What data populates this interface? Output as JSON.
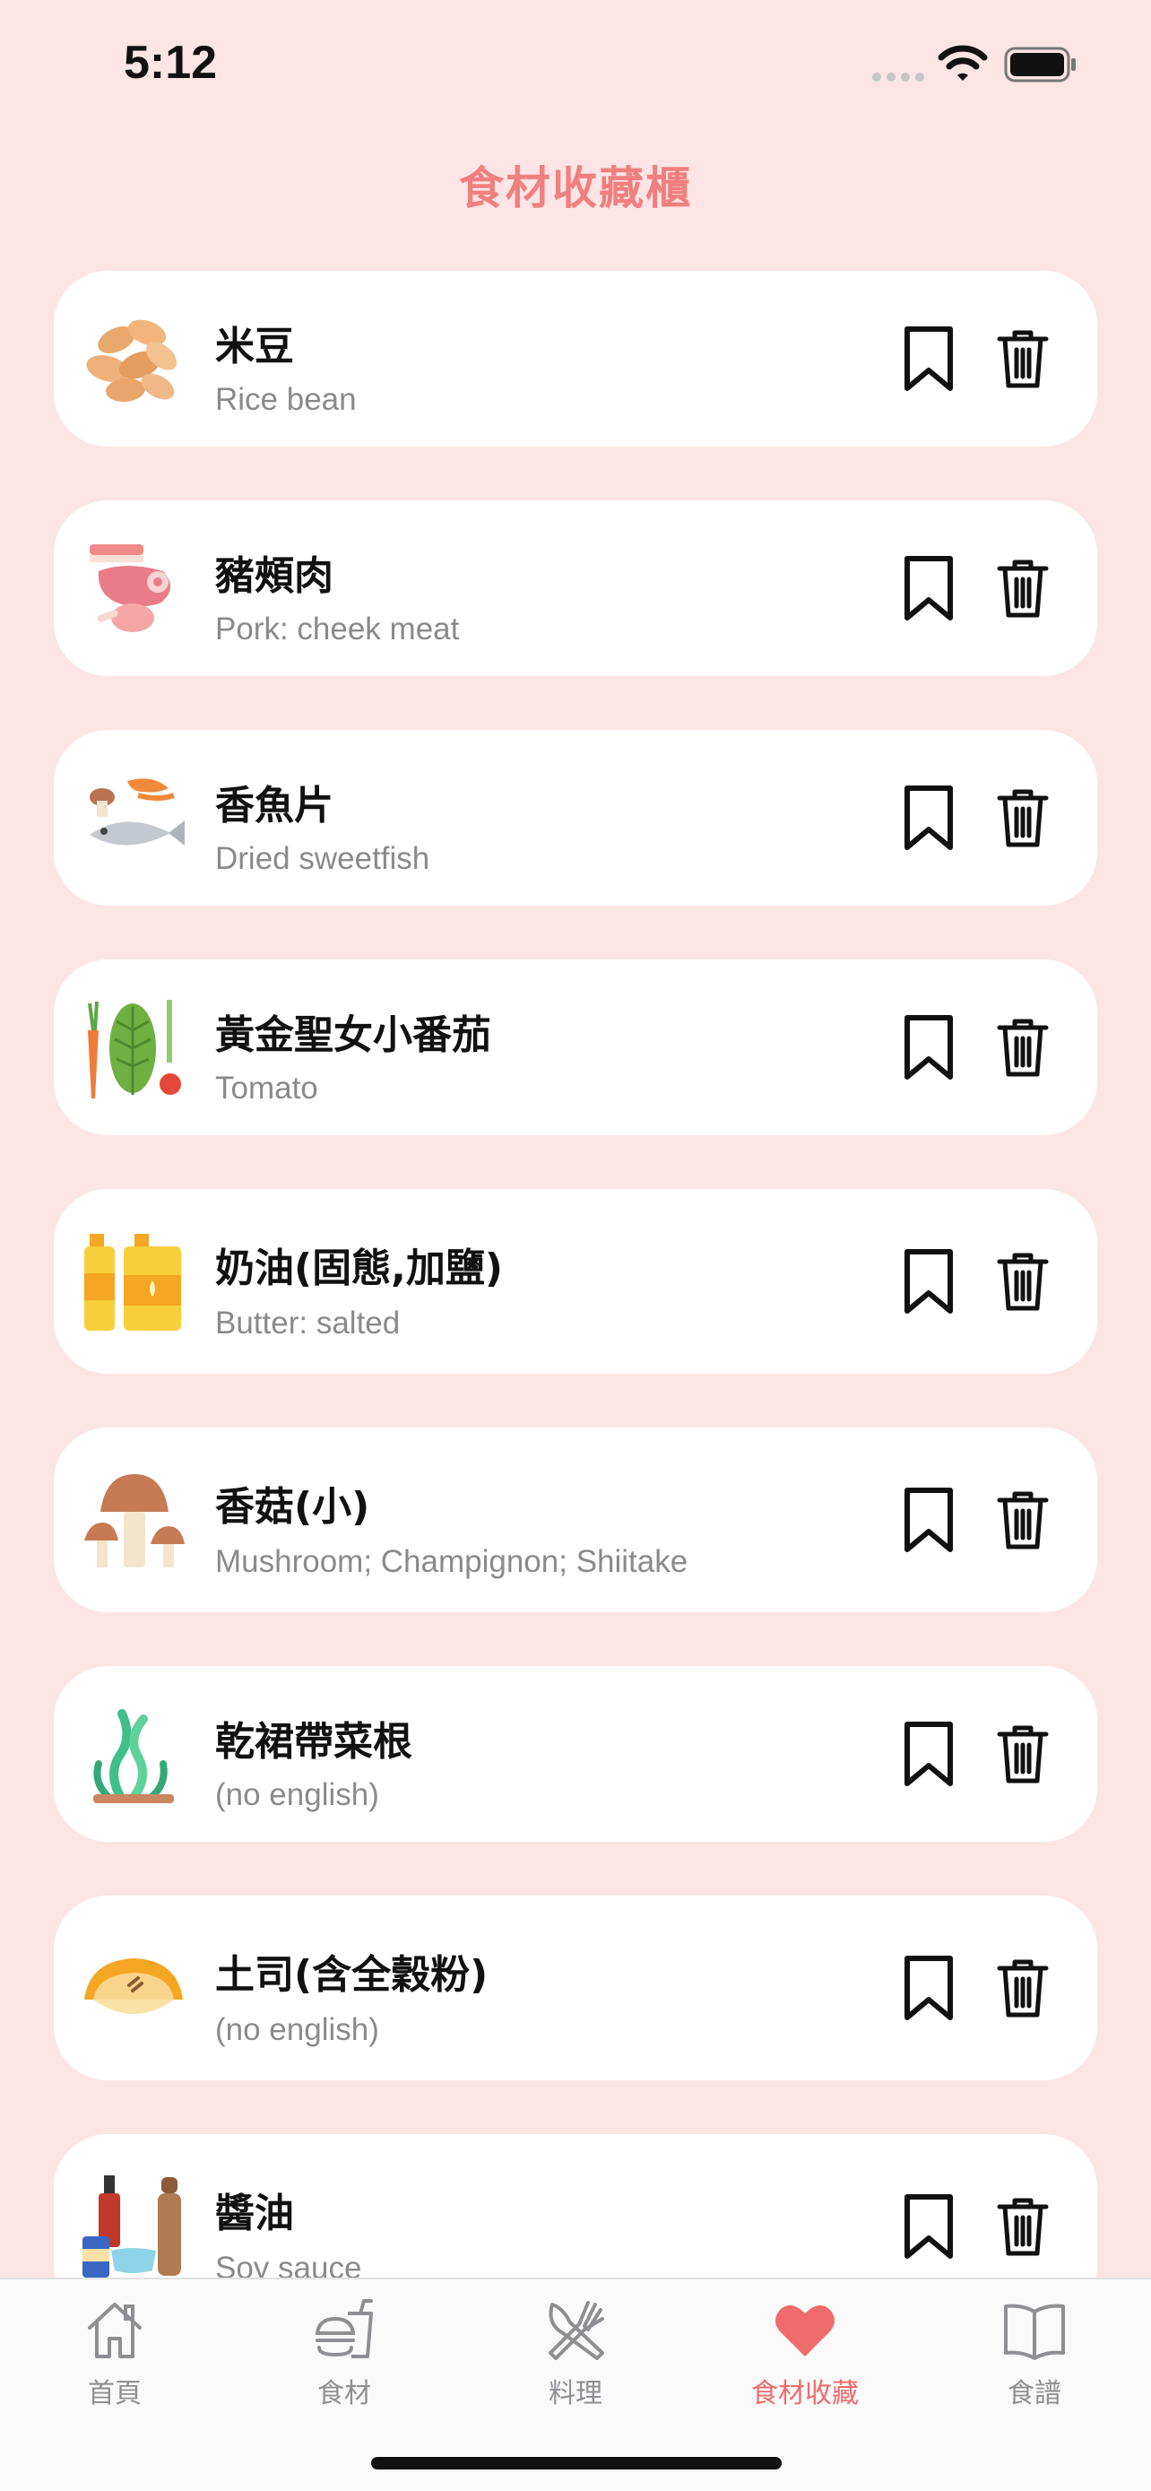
{
  "status": {
    "time": "5:12"
  },
  "page": {
    "title": "食材收藏櫃"
  },
  "items": [
    {
      "name": "米豆",
      "english": "Rice bean",
      "icon": "beans-icon"
    },
    {
      "name": "豬頰肉",
      "english": "Pork: cheek meat",
      "icon": "meat-icon"
    },
    {
      "name": "香魚片",
      "english": "Dried sweetfish",
      "icon": "seafood-icon"
    },
    {
      "name": "黃金聖女小番茄",
      "english": "Tomato",
      "icon": "vegetables-icon"
    },
    {
      "name": "奶油(固態,加鹽)",
      "english": "Butter: salted",
      "icon": "oil-bottles-icon"
    },
    {
      "name": "香菇(小)",
      "english": "Mushroom; Champignon; Shiitake",
      "icon": "mushroom-icon"
    },
    {
      "name": "乾裙帶菜根",
      "english": "(no english)",
      "icon": "seaweed-icon"
    },
    {
      "name": "土司(含全穀粉)",
      "english": "(no english)",
      "icon": "pastry-icon"
    },
    {
      "name": "醬油",
      "english": "Soy sauce",
      "icon": "condiments-icon"
    }
  ],
  "tabs": [
    {
      "label": "首頁",
      "icon": "home-icon"
    },
    {
      "label": "食材",
      "icon": "food-icon"
    },
    {
      "label": "料理",
      "icon": "utensils-icon"
    },
    {
      "label": "食材收藏",
      "icon": "heart-icon",
      "active": true
    },
    {
      "label": "食譜",
      "icon": "book-icon"
    }
  ],
  "colors": {
    "background": "#fde5e5",
    "accent": "#f06b6b",
    "title": "#f07f7f"
  }
}
